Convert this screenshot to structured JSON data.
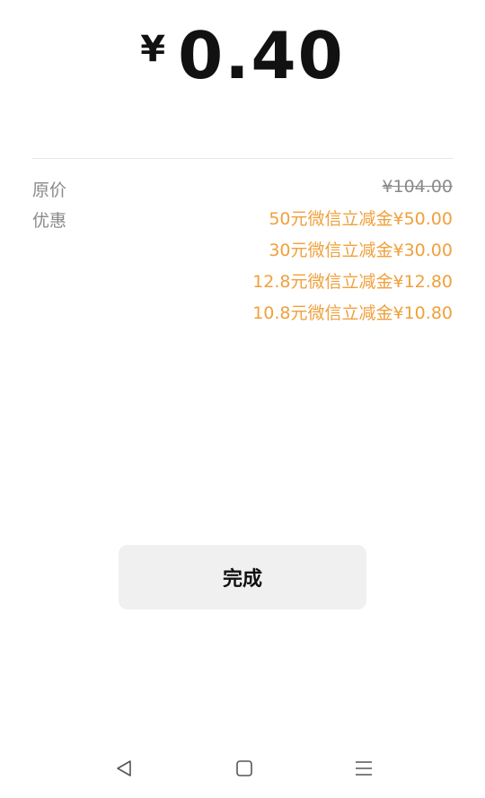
{
  "payment": {
    "currency_symbol": "¥",
    "amount": "0.40"
  },
  "details": {
    "original_label": "原价",
    "original_value": "¥104.00",
    "discount_label": "优惠",
    "discounts": [
      "50元微信立减金¥50.00",
      "30元微信立减金¥30.00",
      "12.8元微信立减金¥12.80",
      "10.8元微信立减金¥10.80"
    ]
  },
  "actions": {
    "done_label": "完成"
  },
  "navbar": {
    "icons": [
      "back-icon",
      "home-icon",
      "menu-icon"
    ]
  },
  "colors": {
    "discount": "#f0a03c",
    "muted": "#8a8a8a",
    "button_bg": "#f0f0f0"
  }
}
